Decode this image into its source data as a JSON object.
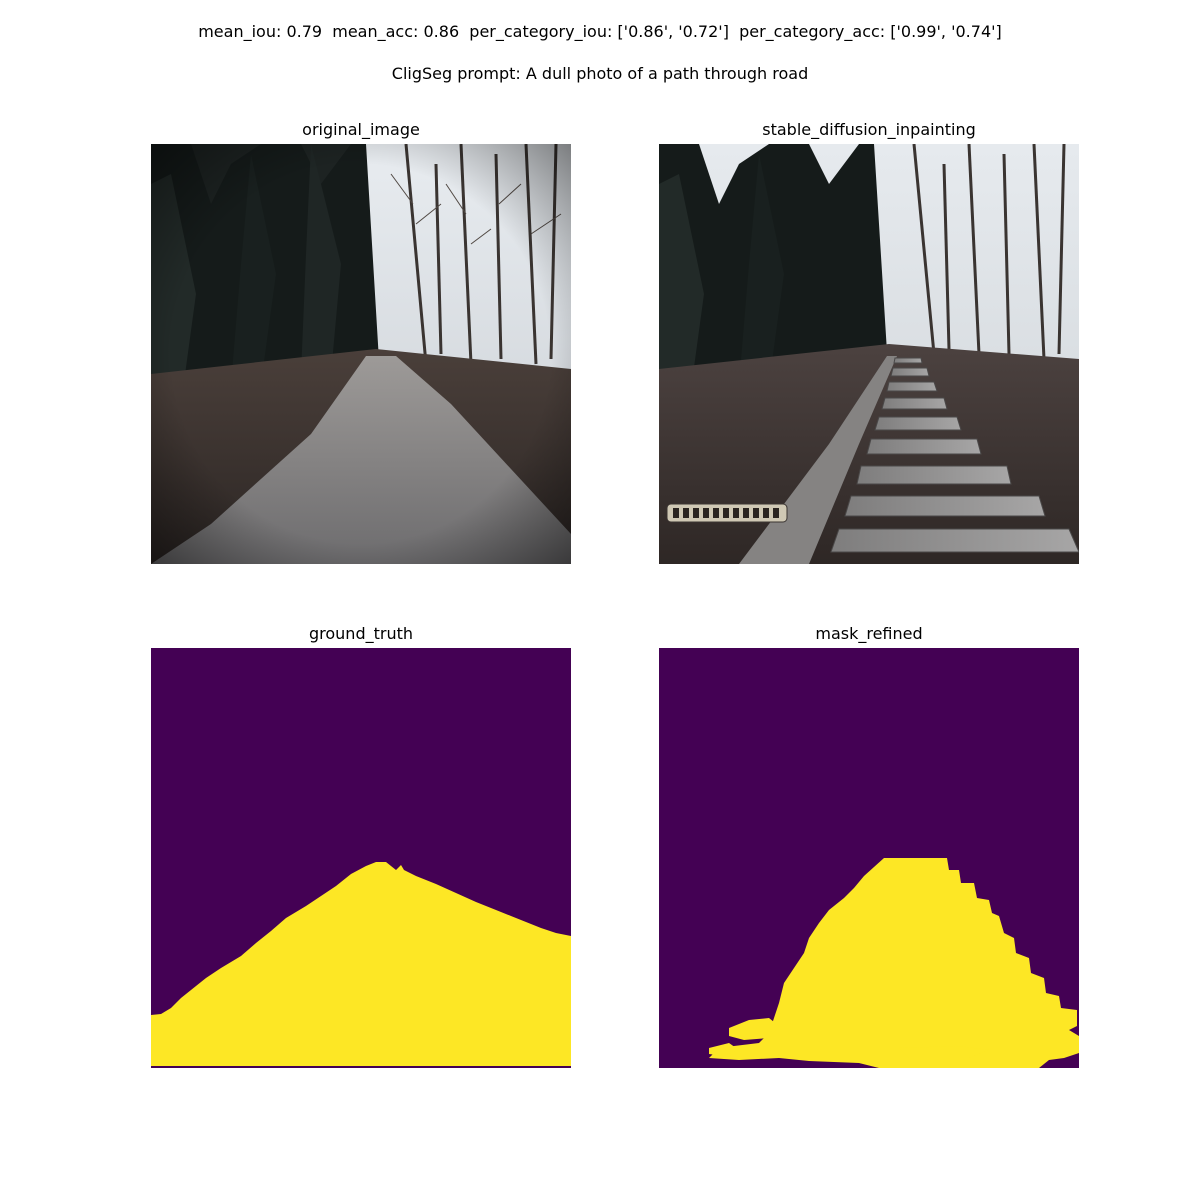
{
  "figure": {
    "metrics_line": "mean_iou: 0.79  mean_acc: 0.86  per_category_iou: ['0.86', '0.72']  per_category_acc: ['0.99', '0.74']",
    "prompt_line": "CligSeg prompt: A dull photo of a path through road"
  },
  "panels": {
    "original": {
      "title": "original_image"
    },
    "inpainting": {
      "title": "stable_diffusion_inpainting"
    },
    "ground_truth": {
      "title": "ground_truth"
    },
    "mask_refined": {
      "title": "mask_refined"
    }
  },
  "colors": {
    "mask_background": "#440154",
    "mask_foreground": "#fde725"
  }
}
